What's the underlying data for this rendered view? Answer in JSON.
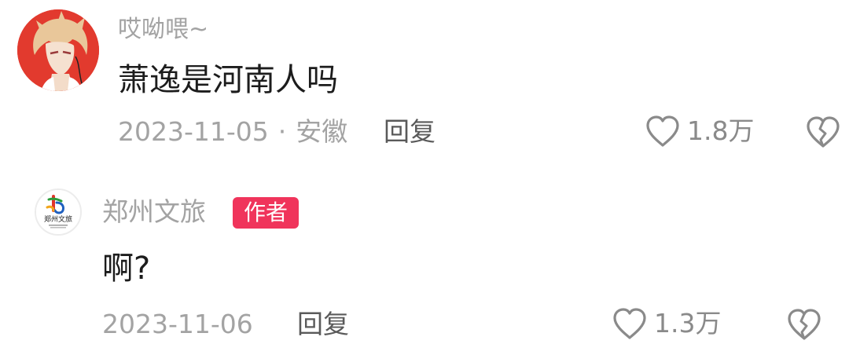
{
  "comments": [
    {
      "username": "哎呦喂~",
      "text": "萧逸是河南人吗",
      "date": "2023-11-05",
      "separator": "·",
      "location": "安徽",
      "reply_label": "回复",
      "likes": "1.8万",
      "avatar_icon": "anime-character-avatar"
    },
    {
      "username": "郑州文旅",
      "badge": "作者",
      "text": "啊?",
      "date": "2023-11-06",
      "reply_label": "回复",
      "likes": "1.3万",
      "avatar_icon": "zhengzhou-tourism-logo",
      "avatar_logo_text": "郑州文旅"
    }
  ],
  "colors": {
    "badge": "#f0345b",
    "avatar_bg": "#e23a2e",
    "secondary_text": "#a3a3a3",
    "primary_text": "#1c1c1c"
  }
}
